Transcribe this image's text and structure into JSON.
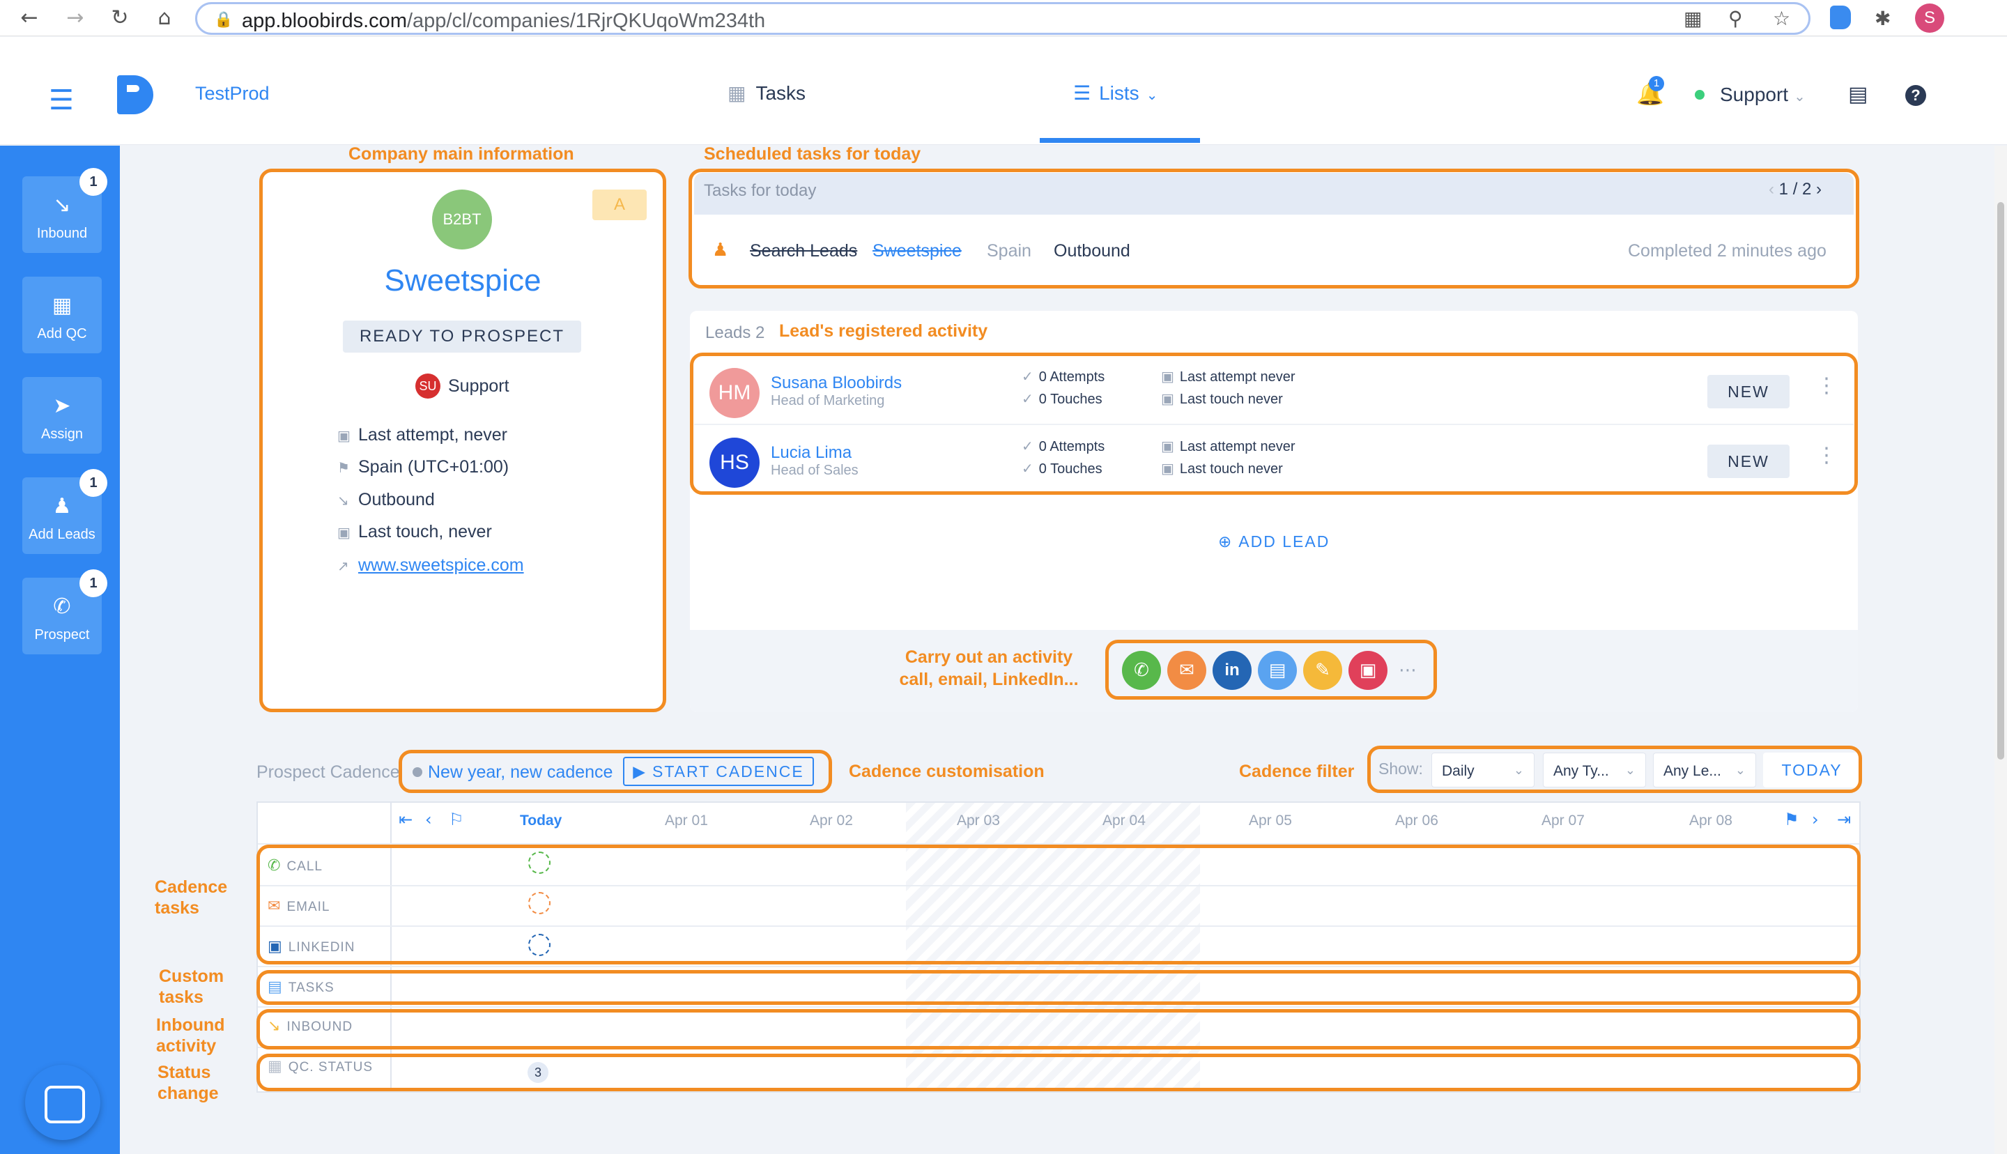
{
  "browser": {
    "url_host": "app.bloobirds.com",
    "url_path": "/app/cl/companies/1RjrQKUqoWm234th",
    "profile_initial": "S"
  },
  "header": {
    "app_name": "TestProd",
    "nav_tasks": "Tasks",
    "nav_lists": "Lists",
    "notifications_count": "1",
    "user_menu": "Support"
  },
  "sidebar": {
    "items": [
      {
        "label": "Inbound",
        "badge": "1"
      },
      {
        "label": "Add QC",
        "badge": ""
      },
      {
        "label": "Assign",
        "badge": ""
      },
      {
        "label": "Add Leads",
        "badge": "1"
      },
      {
        "label": "Prospect",
        "badge": "1"
      }
    ]
  },
  "annotations": {
    "company_info": "Company main information",
    "scheduled_tasks": "Scheduled tasks for today",
    "lead_activity": "Lead's registered activity",
    "carry_out_line1": "Carry out an activity",
    "carry_out_line2": "call, email, LinkedIn...",
    "cadence_custom": "Cadence customisation",
    "cadence_filter": "Cadence filter",
    "cadence_tasks_1": "Cadence",
    "cadence_tasks_2": "tasks",
    "custom_tasks_1": "Custom",
    "custom_tasks_2": "tasks",
    "inbound_activity_1": "Inbound",
    "inbound_activity_2": "activity",
    "status_change_1": "Status",
    "status_change_2": "change"
  },
  "company": {
    "avatar": "B2BT",
    "badge": "A",
    "name": "Sweetspice",
    "status": "READY TO PROSPECT",
    "owner_initials": "SU",
    "owner_name": "Support",
    "last_attempt": "Last attempt, never",
    "timezone": "Spain (UTC+01:00)",
    "source": "Outbound",
    "last_touch": "Last touch, never",
    "website": "www.sweetspice.com"
  },
  "tasks": {
    "title": "Tasks for today",
    "pager": "1 / 2",
    "item": {
      "name": "Search Leads",
      "company": "Sweetspice",
      "country": "Spain",
      "type": "Outbound",
      "completed": "Completed 2 minutes ago"
    }
  },
  "leads": {
    "count_label": "Leads 2",
    "items": [
      {
        "initials": "HM",
        "name": "Susana Bloobirds",
        "title": "Head of Marketing",
        "attempts": "0 Attempts",
        "touches": "0 Touches",
        "last_attempt": "Last attempt never",
        "last_touch": "Last touch never",
        "status": "NEW",
        "color": "#f09a9a"
      },
      {
        "initials": "HS",
        "name": "Lucia Lima",
        "title": "Head of Sales",
        "attempts": "0 Attempts",
        "touches": "0 Touches",
        "last_attempt": "Last attempt never",
        "last_touch": "Last touch never",
        "status": "NEW",
        "color": "#1f47d8"
      }
    ],
    "add_lead": "ADD LEAD"
  },
  "activity_buttons": [
    {
      "icon": "phone-icon",
      "color": "#58b84b"
    },
    {
      "icon": "mail-icon",
      "color": "#f28c44"
    },
    {
      "icon": "linkedin-icon",
      "color": "#2466b4"
    },
    {
      "icon": "task-icon",
      "color": "#5aa3f0"
    },
    {
      "icon": "note-icon",
      "color": "#f5b93a"
    },
    {
      "icon": "calendar-icon",
      "color": "#e0405a"
    }
  ],
  "cadence": {
    "label": "Prospect Cadence",
    "name": "New year, new cadence",
    "start_button": "START CADENCE",
    "show_label": "Show:",
    "filter_period": "Daily",
    "filter_type": "Any Ty...",
    "filter_lead": "Any Le...",
    "today_button": "TODAY",
    "days": [
      "Today",
      "Apr 01",
      "Apr 02",
      "Apr 03",
      "Apr 04",
      "Apr 05",
      "Apr 06",
      "Apr 07",
      "Apr 08"
    ],
    "rows": [
      "CALL",
      "EMAIL",
      "LINKEDIN",
      "TASKS",
      "INBOUND",
      "QC. STATUS"
    ],
    "qc_count": "3"
  }
}
